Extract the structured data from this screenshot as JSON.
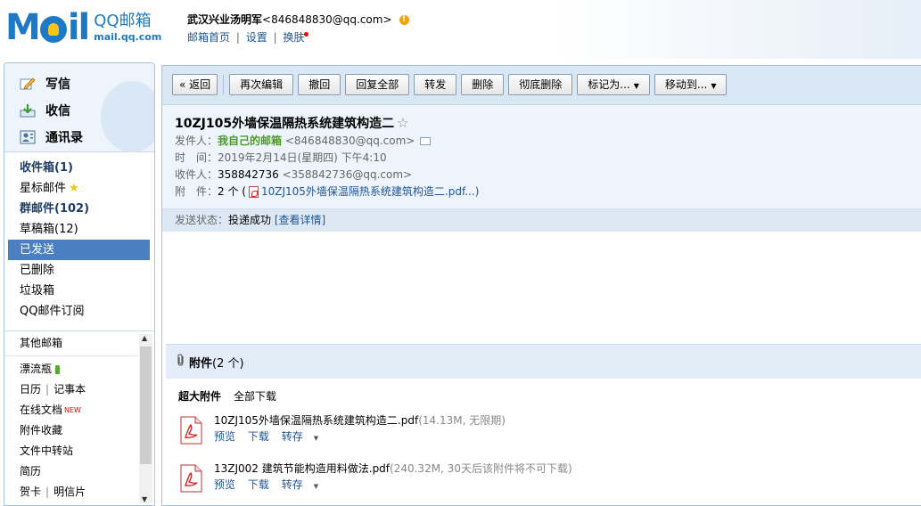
{
  "brand": {
    "logo_text": "M",
    "logo_text2": "il",
    "service_name": "QQ邮箱",
    "service_url": "mail.qq.com"
  },
  "user": {
    "name": "武汉兴业汤明军",
    "email": "<846848830@qq.com>",
    "warn": "!",
    "links": [
      "邮箱首页",
      "设置",
      "换肤"
    ],
    "separator": "|"
  },
  "primary_nav": [
    {
      "label": "写信",
      "icon": "pencil-icon"
    },
    {
      "label": "收信",
      "icon": "inbox-download-icon"
    },
    {
      "label": "通讯录",
      "icon": "contacts-icon"
    }
  ],
  "folders": [
    {
      "label": "收件箱(1)",
      "bold": true
    },
    {
      "label": "星标邮件",
      "star": "★"
    },
    {
      "label": "群邮件(102)",
      "bold": true
    },
    {
      "label": "草稿箱(12)"
    },
    {
      "label": "已发送",
      "selected": true
    },
    {
      "label": "已删除"
    },
    {
      "label": "垃圾箱"
    },
    {
      "label": "QQ邮件订阅"
    }
  ],
  "other_mailbox": "其他邮箱",
  "apps": {
    "drift_bottle": "漂流瓶",
    "calendar": "日历",
    "notepad": "记事本",
    "sep": "|",
    "online_docs": "在线文档",
    "new_badge": "NEW",
    "attachments": "附件收藏",
    "file_transfer": "文件中转站",
    "resume": "简历",
    "card": "贺卡",
    "postcard": "明信片"
  },
  "toolbar": {
    "back": "« 返回",
    "buttons": [
      "再次编辑",
      "撤回",
      "回复全部",
      "转发",
      "删除",
      "彻底删除"
    ],
    "mark_as": "标记为...",
    "move_to": "移动到...",
    "caret": "▼"
  },
  "mail": {
    "subject": "10ZJ105外墙保温隔热系统建筑构造二",
    "fav_icon": "☆",
    "from_label": "发件人：",
    "from_name": "我自己的邮箱",
    "from_email": "<846848830@qq.com>",
    "time_label": "时　间：",
    "time_value": "2019年2月14日(星期四) 下午4:10",
    "to_label": "收件人：",
    "to_name": "358842736",
    "to_email": "<358842736@qq.com>",
    "attach_label": "附　件：",
    "attach_count": "2 个 (",
    "attach_link": "10ZJ105外墙保温隔热系统建筑构造二.pdf...)",
    "status_label": "发送状态：",
    "status_value": "投递成功",
    "status_link": "[查看详情]"
  },
  "attachments": {
    "clip_icon": "⌀",
    "title": "附件",
    "count": "(2 个)",
    "super_label": "超大附件",
    "download_all": "全部下载",
    "files": [
      {
        "name": "10ZJ105外墙保温隔热系统建筑构造二.pdf",
        "meta": "(14.13M, 无限期)",
        "preview": "预览",
        "download": "下载",
        "save": "转存"
      },
      {
        "name": "13ZJ002 建筑节能构造用料做法.pdf",
        "meta": "(240.32M, 30天后该附件将不可下载)",
        "preview": "预览",
        "download": "下载",
        "save": "转存"
      }
    ]
  }
}
